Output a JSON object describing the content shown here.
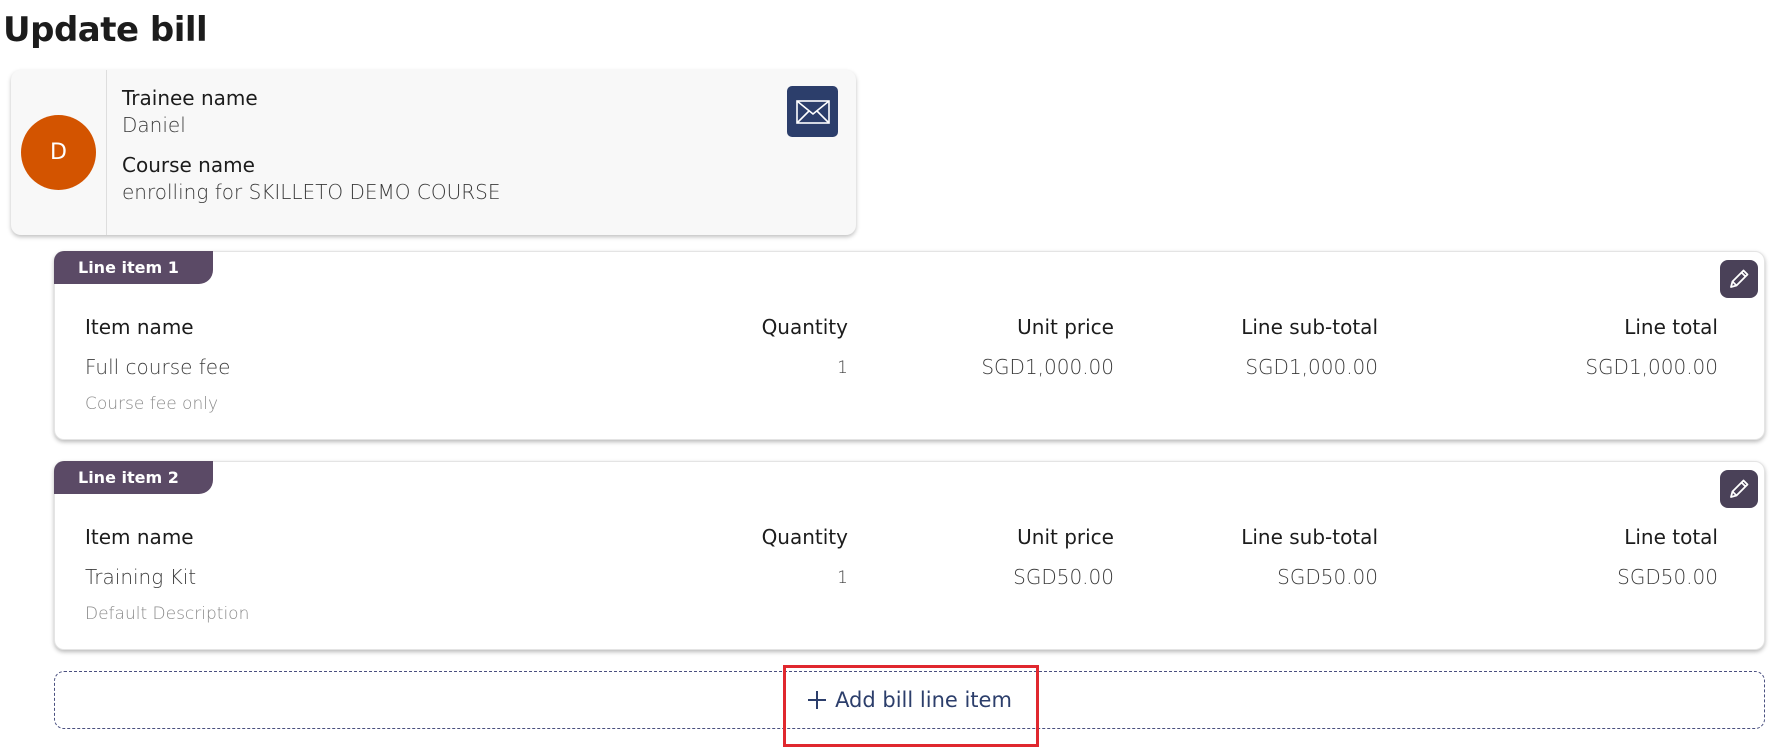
{
  "page": {
    "title": "Update bill"
  },
  "trainee_card": {
    "avatar_initial": "D",
    "avatar_color": "#d35400",
    "trainee_label": "Trainee name",
    "trainee_value": "Daniel",
    "course_label": "Course name",
    "course_value": "enrolling for SKILLETO DEMO COURSE",
    "mail_icon": "envelope-icon"
  },
  "columns": {
    "item_name": "Item name",
    "quantity": "Quantity",
    "unit_price": "Unit price",
    "line_subtotal": "Line sub-total",
    "line_total": "Line total"
  },
  "line_items": [
    {
      "tag": "Line item 1",
      "item_name": "Full course fee",
      "description": "Course fee only",
      "quantity": "1",
      "unit_price": "SGD1,000.00",
      "line_subtotal": "SGD1,000.00",
      "line_total": "SGD1,000.00"
    },
    {
      "tag": "Line item 2",
      "item_name": "Training Kit",
      "description": "Default Description",
      "quantity": "1",
      "unit_price": "SGD50.00",
      "line_subtotal": "SGD50.00",
      "line_total": "SGD50.00"
    }
  ],
  "add_line": {
    "label": "Add bill line item",
    "icon": "plus-icon"
  },
  "colors": {
    "tag": "#5b4a66",
    "edit_button": "#4a4158",
    "mail_button": "#2c3e6b",
    "highlight": "#e0282e"
  }
}
